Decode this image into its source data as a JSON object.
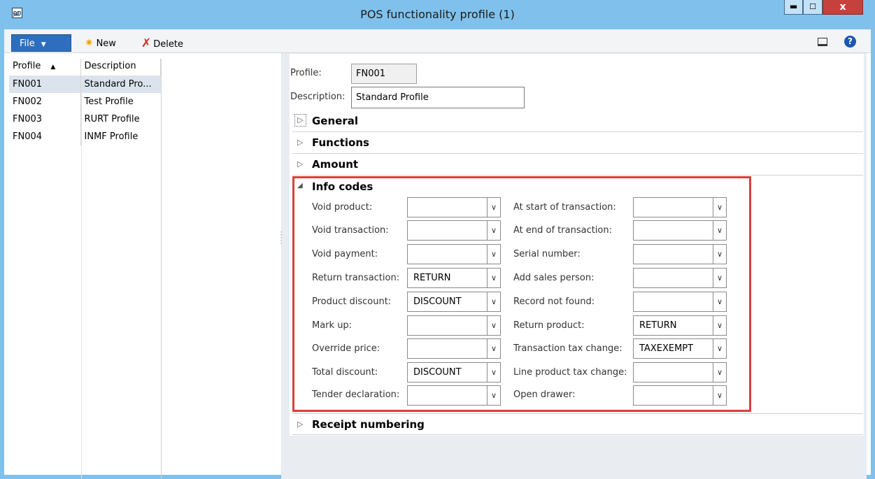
{
  "window": {
    "title": "POS functionality profile (1)",
    "app_icon_glyph": "ஹ"
  },
  "toolbar": {
    "file_label": "File",
    "new_label": "New",
    "delete_label": "Delete"
  },
  "grid": {
    "headers": [
      "Profile",
      "Description"
    ],
    "rows": [
      {
        "profile": "FN001",
        "description": "Standard Pro..."
      },
      {
        "profile": "FN002",
        "description": "Test Profile"
      },
      {
        "profile": "FN003",
        "description": "RURT Profile"
      },
      {
        "profile": "FN004",
        "description": "INMF Profile"
      }
    ]
  },
  "form": {
    "profile_label": "Profile:",
    "profile_value": "FN001",
    "description_label": "Description:",
    "description_value": "Standard Profile"
  },
  "sections": {
    "general": "General",
    "functions": "Functions",
    "amount": "Amount",
    "info_codes": "Info codes",
    "receipt_numbering": "Receipt numbering"
  },
  "info_codes": {
    "left": [
      {
        "label": "Void product:",
        "value": ""
      },
      {
        "label": "Void transaction:",
        "value": ""
      },
      {
        "label": "Void payment:",
        "value": ""
      },
      {
        "label": "Return transaction:",
        "value": "RETURN"
      },
      {
        "label": "Product discount:",
        "value": "DISCOUNT"
      },
      {
        "label": "Mark up:",
        "value": ""
      },
      {
        "label": "Override price:",
        "value": ""
      },
      {
        "label": "Total discount:",
        "value": "DISCOUNT"
      },
      {
        "label": "Tender declaration:",
        "value": ""
      }
    ],
    "right": [
      {
        "label": "At start of transaction:",
        "value": ""
      },
      {
        "label": "At end of transaction:",
        "value": ""
      },
      {
        "label": "Serial number:",
        "value": ""
      },
      {
        "label": "Add sales person:",
        "value": ""
      },
      {
        "label": "Record not found:",
        "value": ""
      },
      {
        "label": "Return product:",
        "value": "RETURN"
      },
      {
        "label": "Transaction tax change:",
        "value": "TAXEXEMPT"
      },
      {
        "label": "Line product tax change:",
        "value": ""
      },
      {
        "label": "Open drawer:",
        "value": ""
      }
    ]
  },
  "colors": {
    "title_bar": "#7fc1ec",
    "file_button": "#2d6fbd",
    "close_button": "#c7413c",
    "highlight_border": "#d9403f"
  }
}
